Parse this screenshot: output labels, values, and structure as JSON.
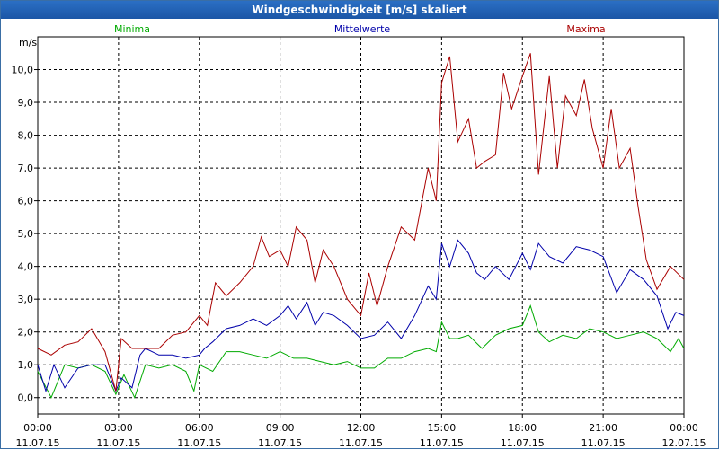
{
  "window": {
    "title": "Windgeschwindigkeit [m/s] skaliert"
  },
  "colors": {
    "Minima": "#00aa00",
    "Mittelwerte": "#0000aa",
    "Maxima": "#aa0000"
  },
  "chart_data": {
    "type": "line",
    "title": "Windgeschwindigkeit [m/s] skaliert",
    "ylabel": "m/s",
    "xlabel": "",
    "ylim": [
      -0.5,
      11.0
    ],
    "xlim": [
      0,
      24
    ],
    "grid": true,
    "legend_placement": "top",
    "yticks": [
      0,
      1,
      2,
      3,
      4,
      5,
      6,
      7,
      8,
      9,
      10
    ],
    "ytick_labels": [
      "0,0",
      "1,0",
      "2,0",
      "3,0",
      "4,0",
      "5,0",
      "6,0",
      "7,0",
      "8,0",
      "9,0",
      "10,0"
    ],
    "xticks": [
      {
        "x": 0,
        "time": "00:00",
        "date": "11.07.15"
      },
      {
        "x": 3,
        "time": "03:00",
        "date": "11.07.15"
      },
      {
        "x": 6,
        "time": "06:00",
        "date": "11.07.15"
      },
      {
        "x": 9,
        "time": "09:00",
        "date": "11.07.15"
      },
      {
        "x": 12,
        "time": "12:00",
        "date": "11.07.15"
      },
      {
        "x": 15,
        "time": "15:00",
        "date": "11.07.15"
      },
      {
        "x": 18,
        "time": "18:00",
        "date": "11.07.15"
      },
      {
        "x": 21,
        "time": "21:00",
        "date": "11.07.15"
      },
      {
        "x": 24,
        "time": "00:00",
        "date": "12.07.15"
      }
    ],
    "series": [
      {
        "name": "Minima",
        "values": [
          [
            0.0,
            0.8
          ],
          [
            0.5,
            0.0
          ],
          [
            1.0,
            1.0
          ],
          [
            1.5,
            0.9
          ],
          [
            2.0,
            1.0
          ],
          [
            2.5,
            0.8
          ],
          [
            2.9,
            0.1
          ],
          [
            3.2,
            0.7
          ],
          [
            3.6,
            0.0
          ],
          [
            4.0,
            1.0
          ],
          [
            4.5,
            0.9
          ],
          [
            5.0,
            1.0
          ],
          [
            5.5,
            0.8
          ],
          [
            5.8,
            0.2
          ],
          [
            6.0,
            1.0
          ],
          [
            6.5,
            0.8
          ],
          [
            7.0,
            1.4
          ],
          [
            7.5,
            1.4
          ],
          [
            8.0,
            1.3
          ],
          [
            8.5,
            1.2
          ],
          [
            9.0,
            1.4
          ],
          [
            9.5,
            1.2
          ],
          [
            10.0,
            1.2
          ],
          [
            10.5,
            1.1
          ],
          [
            11.0,
            1.0
          ],
          [
            11.5,
            1.1
          ],
          [
            12.0,
            0.9
          ],
          [
            12.5,
            0.9
          ],
          [
            13.0,
            1.2
          ],
          [
            13.5,
            1.2
          ],
          [
            14.0,
            1.4
          ],
          [
            14.5,
            1.5
          ],
          [
            14.8,
            1.4
          ],
          [
            15.0,
            2.3
          ],
          [
            15.3,
            1.8
          ],
          [
            15.6,
            1.8
          ],
          [
            16.0,
            1.9
          ],
          [
            16.5,
            1.5
          ],
          [
            17.0,
            1.9
          ],
          [
            17.5,
            2.1
          ],
          [
            18.0,
            2.2
          ],
          [
            18.3,
            2.8
          ],
          [
            18.6,
            2.0
          ],
          [
            19.0,
            1.7
          ],
          [
            19.5,
            1.9
          ],
          [
            20.0,
            1.8
          ],
          [
            20.5,
            2.1
          ],
          [
            21.0,
            2.0
          ],
          [
            21.5,
            1.8
          ],
          [
            22.0,
            1.9
          ],
          [
            22.5,
            2.0
          ],
          [
            23.0,
            1.8
          ],
          [
            23.5,
            1.4
          ],
          [
            23.8,
            1.8
          ],
          [
            24.0,
            1.5
          ]
        ]
      },
      {
        "name": "Mittelwerte",
        "values": [
          [
            0.0,
            1.0
          ],
          [
            0.3,
            0.2
          ],
          [
            0.6,
            1.0
          ],
          [
            1.0,
            0.3
          ],
          [
            1.5,
            0.9
          ],
          [
            2.0,
            1.0
          ],
          [
            2.5,
            1.0
          ],
          [
            2.9,
            0.2
          ],
          [
            3.1,
            0.6
          ],
          [
            3.5,
            0.3
          ],
          [
            3.8,
            1.3
          ],
          [
            4.0,
            1.5
          ],
          [
            4.5,
            1.3
          ],
          [
            5.0,
            1.3
          ],
          [
            5.5,
            1.2
          ],
          [
            6.0,
            1.3
          ],
          [
            6.2,
            1.5
          ],
          [
            6.5,
            1.7
          ],
          [
            7.0,
            2.1
          ],
          [
            7.5,
            2.2
          ],
          [
            8.0,
            2.4
          ],
          [
            8.5,
            2.2
          ],
          [
            9.0,
            2.5
          ],
          [
            9.3,
            2.8
          ],
          [
            9.6,
            2.4
          ],
          [
            10.0,
            2.9
          ],
          [
            10.3,
            2.2
          ],
          [
            10.6,
            2.6
          ],
          [
            11.0,
            2.5
          ],
          [
            11.5,
            2.2
          ],
          [
            12.0,
            1.8
          ],
          [
            12.5,
            1.9
          ],
          [
            13.0,
            2.3
          ],
          [
            13.5,
            1.8
          ],
          [
            14.0,
            2.5
          ],
          [
            14.5,
            3.4
          ],
          [
            14.8,
            3.0
          ],
          [
            15.0,
            4.7
          ],
          [
            15.3,
            4.0
          ],
          [
            15.6,
            4.8
          ],
          [
            16.0,
            4.4
          ],
          [
            16.3,
            3.8
          ],
          [
            16.6,
            3.6
          ],
          [
            17.0,
            4.0
          ],
          [
            17.5,
            3.6
          ],
          [
            18.0,
            4.4
          ],
          [
            18.3,
            3.9
          ],
          [
            18.6,
            4.7
          ],
          [
            19.0,
            4.3
          ],
          [
            19.5,
            4.1
          ],
          [
            20.0,
            4.6
          ],
          [
            20.5,
            4.5
          ],
          [
            21.0,
            4.3
          ],
          [
            21.5,
            3.2
          ],
          [
            22.0,
            3.9
          ],
          [
            22.5,
            3.6
          ],
          [
            23.0,
            3.1
          ],
          [
            23.4,
            2.1
          ],
          [
            23.7,
            2.6
          ],
          [
            24.0,
            2.5
          ]
        ]
      },
      {
        "name": "Maxima",
        "values": [
          [
            0.0,
            1.5
          ],
          [
            0.5,
            1.3
          ],
          [
            1.0,
            1.6
          ],
          [
            1.5,
            1.7
          ],
          [
            2.0,
            2.1
          ],
          [
            2.5,
            1.4
          ],
          [
            2.9,
            0.2
          ],
          [
            3.1,
            1.8
          ],
          [
            3.5,
            1.5
          ],
          [
            4.0,
            1.5
          ],
          [
            4.5,
            1.5
          ],
          [
            5.0,
            1.9
          ],
          [
            5.5,
            2.0
          ],
          [
            6.0,
            2.5
          ],
          [
            6.3,
            2.2
          ],
          [
            6.6,
            3.5
          ],
          [
            7.0,
            3.1
          ],
          [
            7.5,
            3.5
          ],
          [
            8.0,
            4.0
          ],
          [
            8.3,
            4.9
          ],
          [
            8.6,
            4.3
          ],
          [
            9.0,
            4.5
          ],
          [
            9.3,
            4.0
          ],
          [
            9.6,
            5.2
          ],
          [
            10.0,
            4.8
          ],
          [
            10.3,
            3.5
          ],
          [
            10.6,
            4.5
          ],
          [
            11.0,
            4.0
          ],
          [
            11.5,
            3.0
          ],
          [
            12.0,
            2.5
          ],
          [
            12.3,
            3.8
          ],
          [
            12.6,
            2.8
          ],
          [
            13.0,
            4.0
          ],
          [
            13.5,
            5.2
          ],
          [
            14.0,
            4.8
          ],
          [
            14.5,
            7.0
          ],
          [
            14.8,
            6.0
          ],
          [
            15.0,
            9.6
          ],
          [
            15.3,
            10.4
          ],
          [
            15.6,
            7.8
          ],
          [
            16.0,
            8.5
          ],
          [
            16.3,
            7.0
          ],
          [
            16.6,
            7.2
          ],
          [
            17.0,
            7.4
          ],
          [
            17.3,
            9.9
          ],
          [
            17.6,
            8.8
          ],
          [
            18.0,
            9.8
          ],
          [
            18.3,
            10.5
          ],
          [
            18.6,
            6.8
          ],
          [
            19.0,
            9.8
          ],
          [
            19.3,
            7.0
          ],
          [
            19.6,
            9.2
          ],
          [
            20.0,
            8.6
          ],
          [
            20.3,
            9.7
          ],
          [
            20.6,
            8.2
          ],
          [
            21.0,
            7.0
          ],
          [
            21.3,
            8.8
          ],
          [
            21.6,
            7.0
          ],
          [
            22.0,
            7.6
          ],
          [
            22.3,
            5.8
          ],
          [
            22.6,
            4.2
          ],
          [
            23.0,
            3.3
          ],
          [
            23.5,
            4.0
          ],
          [
            24.0,
            3.6
          ]
        ]
      }
    ]
  }
}
